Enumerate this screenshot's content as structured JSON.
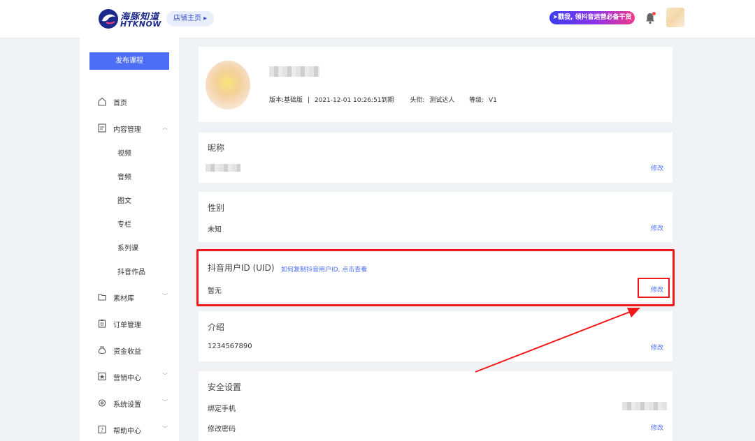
{
  "header": {
    "logo_cn": "海豚知道",
    "logo_en": "HTKNOW",
    "store_button": "店铺主页 ▸",
    "promo": "➤戳我, 领抖音运营必备干货"
  },
  "sidebar": {
    "publish_button": "发布课程",
    "items": {
      "home": "首页",
      "content": "内容管理",
      "materials": "素材库",
      "orders": "订单管理",
      "income": "资金收益",
      "marketing": "营销中心",
      "settings": "系统设置",
      "help": "帮助中心"
    },
    "sub_items": {
      "video": "视频",
      "audio": "音频",
      "article": "图文",
      "column": "专栏",
      "series": "系列课",
      "douyin": "抖音作品"
    }
  },
  "profile": {
    "version": "版本:基础版",
    "separator": "|",
    "expiry": "2021-12-01 10:26:51到期",
    "title_label": "头衔:",
    "title_value": "测试达人",
    "level_label": "等级:",
    "level_value": "V1"
  },
  "sections": {
    "nickname": {
      "title": "昵称",
      "edit": "修改"
    },
    "gender": {
      "title": "性别",
      "value": "未知",
      "edit": "修改"
    },
    "uid": {
      "title": "抖音用户ID (UID)",
      "help": "如何复制抖音用户ID, 点击查看",
      "value": "暂无",
      "edit": "修改"
    },
    "intro": {
      "title": "介绍",
      "value": "1234567890",
      "edit": "修改"
    },
    "security": {
      "title": "安全设置",
      "bind_phone": "绑定手机",
      "change_password": "修改密码",
      "edit": "修改"
    }
  },
  "colors": {
    "accent": "#4c6ef5",
    "highlight": "#f01818"
  }
}
